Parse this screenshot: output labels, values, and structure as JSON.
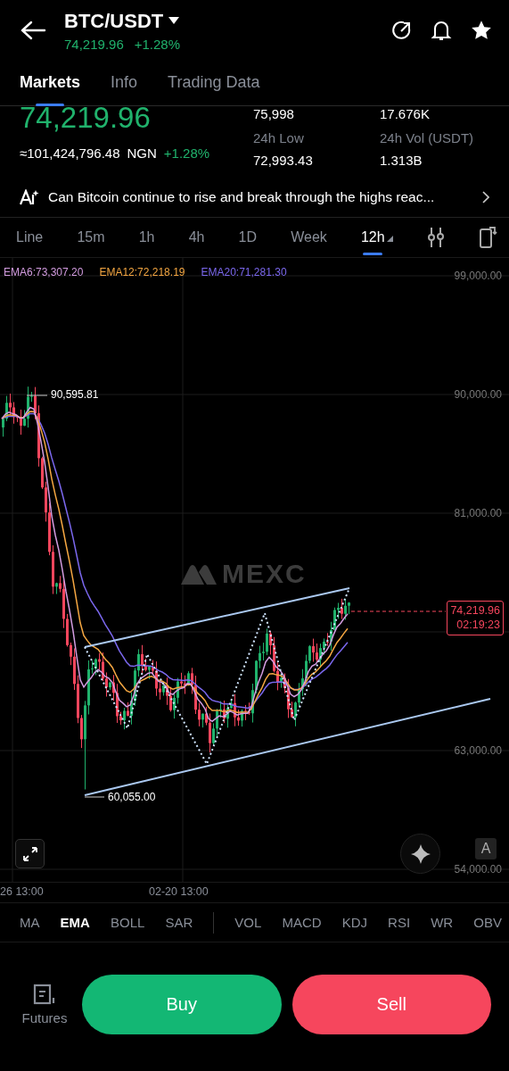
{
  "header": {
    "title": "BTC/USDT",
    "price": "74,219.96",
    "change": "+1.28%"
  },
  "tabs": [
    {
      "label": "Markets",
      "selected": true
    },
    {
      "label": "Info",
      "selected": false
    },
    {
      "label": "Trading Data",
      "selected": false
    }
  ],
  "ticker": {
    "last_price": "74,219.96",
    "converted": "≈101,424,796.48",
    "currency": "NGN",
    "change": "+1.28%",
    "stats": [
      {
        "value": "75,998"
      },
      {
        "value": "17.676K"
      },
      {
        "label": "24h Low",
        "value": "72,993.43"
      },
      {
        "label": "24h Vol (USDT)",
        "value": "1.313B"
      }
    ]
  },
  "ai_banner": {
    "text": "Can Bitcoin continue to rise and break through the highs reac..."
  },
  "intervals": [
    {
      "label": "Line",
      "selected": false
    },
    {
      "label": "15m",
      "selected": false
    },
    {
      "label": "1h",
      "selected": false
    },
    {
      "label": "4h",
      "selected": false
    },
    {
      "label": "1D",
      "selected": false
    },
    {
      "label": "Week",
      "selected": false
    },
    {
      "label": "12h",
      "selected": true
    }
  ],
  "chart": {
    "legend": [
      {
        "label": "EMA6:73,307.20",
        "color": "#d39ce0"
      },
      {
        "label": "EMA12:72,218.19",
        "color": "#f5a742"
      },
      {
        "label": "EMA20:71,281.30",
        "color": "#7b68ee"
      }
    ],
    "price_axis": [
      "99,000.00",
      "90,000.00",
      "81,000.00",
      "63,000.00",
      "54,000.00"
    ],
    "time_axis": [
      "26 13:00",
      "02-20 13:00"
    ],
    "high_marker": "90,595.81",
    "low_marker": "60,055.00",
    "last_price_tag": {
      "price": "74,219.96",
      "countdown": "02:19:23"
    },
    "watermark": "MEXC",
    "auto_button": "A"
  },
  "indicators": {
    "main": [
      {
        "label": "MA",
        "selected": false
      },
      {
        "label": "EMA",
        "selected": true
      },
      {
        "label": "BOLL",
        "selected": false
      },
      {
        "label": "SAR",
        "selected": false
      }
    ],
    "sub": [
      {
        "label": "VOL",
        "selected": false
      },
      {
        "label": "MACD",
        "selected": false
      },
      {
        "label": "KDJ",
        "selected": false
      },
      {
        "label": "RSI",
        "selected": false
      },
      {
        "label": "WR",
        "selected": false
      },
      {
        "label": "OBV",
        "selected": false
      }
    ]
  },
  "footer": {
    "futures_label": "Futures",
    "buy": "Buy",
    "sell": "Sell"
  }
}
